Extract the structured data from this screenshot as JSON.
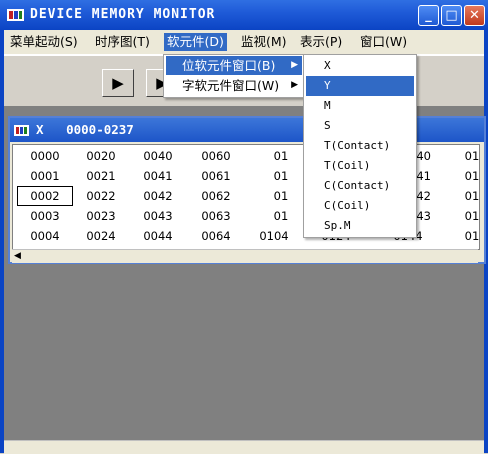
{
  "window": {
    "title": "DEVICE MEMORY MONITOR",
    "minimize_glyph": "_",
    "maximize_glyph": "□",
    "close_glyph": "✕"
  },
  "menubar": {
    "items": [
      {
        "label": "菜单起动(S)"
      },
      {
        "label": "时序图(T)"
      },
      {
        "label": "软元件(D)"
      },
      {
        "label": "监视(M)"
      },
      {
        "label": "表示(P)"
      },
      {
        "label": "窗口(W)"
      }
    ]
  },
  "toolbar": {
    "buttons": [
      {
        "glyph": "▶"
      },
      {
        "glyph": "▶"
      }
    ]
  },
  "device_menu": {
    "items": [
      {
        "label": "位软元件窗口(B)",
        "arrow": "▶"
      },
      {
        "label": "字软元件窗口(W)",
        "arrow": "▶"
      }
    ]
  },
  "bit_device_submenu": {
    "items": [
      "X",
      "Y",
      "M",
      "S",
      "T(Contact)",
      "T(Coil)",
      "C(Contact)",
      "C(Coil)",
      "Sp.M"
    ],
    "selected": "Y"
  },
  "child_window": {
    "title": "X   0000-0237",
    "rows": [
      [
        "0000",
        "0020",
        "0040",
        "0060",
        "01",
        "",
        "",
        "140",
        "01"
      ],
      [
        "0001",
        "0021",
        "0041",
        "0061",
        "01",
        "",
        "",
        "141",
        "01"
      ],
      [
        "0002",
        "0022",
        "0042",
        "0062",
        "01",
        "",
        "",
        "142",
        "01"
      ],
      [
        "0003",
        "0023",
        "0043",
        "0063",
        "01",
        "",
        "",
        "143",
        "01"
      ],
      [
        "0004",
        "0024",
        "0044",
        "0064",
        "0104",
        "0124",
        "",
        "0144",
        "01"
      ]
    ],
    "selected_cell": "0002",
    "scroll_left_glyph": "◀"
  },
  "colors": {
    "title_bar": "#0b44c4",
    "menu_highlight": "#316ac5",
    "mdi_background": "#808080"
  }
}
